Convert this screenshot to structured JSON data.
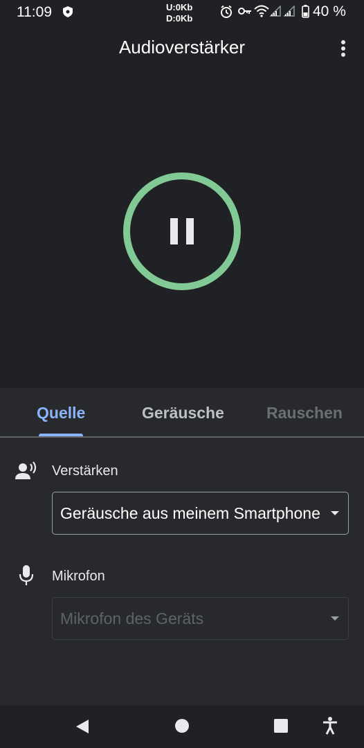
{
  "status_bar": {
    "time": "11:09",
    "net_up": "U:0Kb",
    "net_down": "D:0Kb",
    "battery": "40 %",
    "icons": [
      "shield-notification-icon",
      "alarm-icon",
      "vpn-key-icon",
      "wifi-icon",
      "signal-icon",
      "signal-icon",
      "battery-icon"
    ]
  },
  "app_bar": {
    "title": "Audioverstärker",
    "menu_icon": "more-vert-icon"
  },
  "player": {
    "state_icon": "pause-icon",
    "accent": "#81c995"
  },
  "tabs": [
    {
      "label": "Quelle",
      "selected": true
    },
    {
      "label": "Geräusche",
      "selected": false
    },
    {
      "label": "Rauschen",
      "selected": false
    }
  ],
  "source": {
    "amplify_label": "Verstärken",
    "amplify_icon": "record-voice-icon",
    "amplify_value": "Geräusche aus meinem Smartphone",
    "mic_label": "Mikrofon",
    "mic_icon": "mic-icon",
    "mic_value": "Mikrofon des Geräts"
  },
  "nav_bar": {
    "icons": [
      "back-icon",
      "home-icon",
      "recents-icon",
      "accessibility-icon"
    ]
  },
  "colors": {
    "tab_active": "#8ab4f8",
    "background": "#202124",
    "panel": "#28292c"
  }
}
